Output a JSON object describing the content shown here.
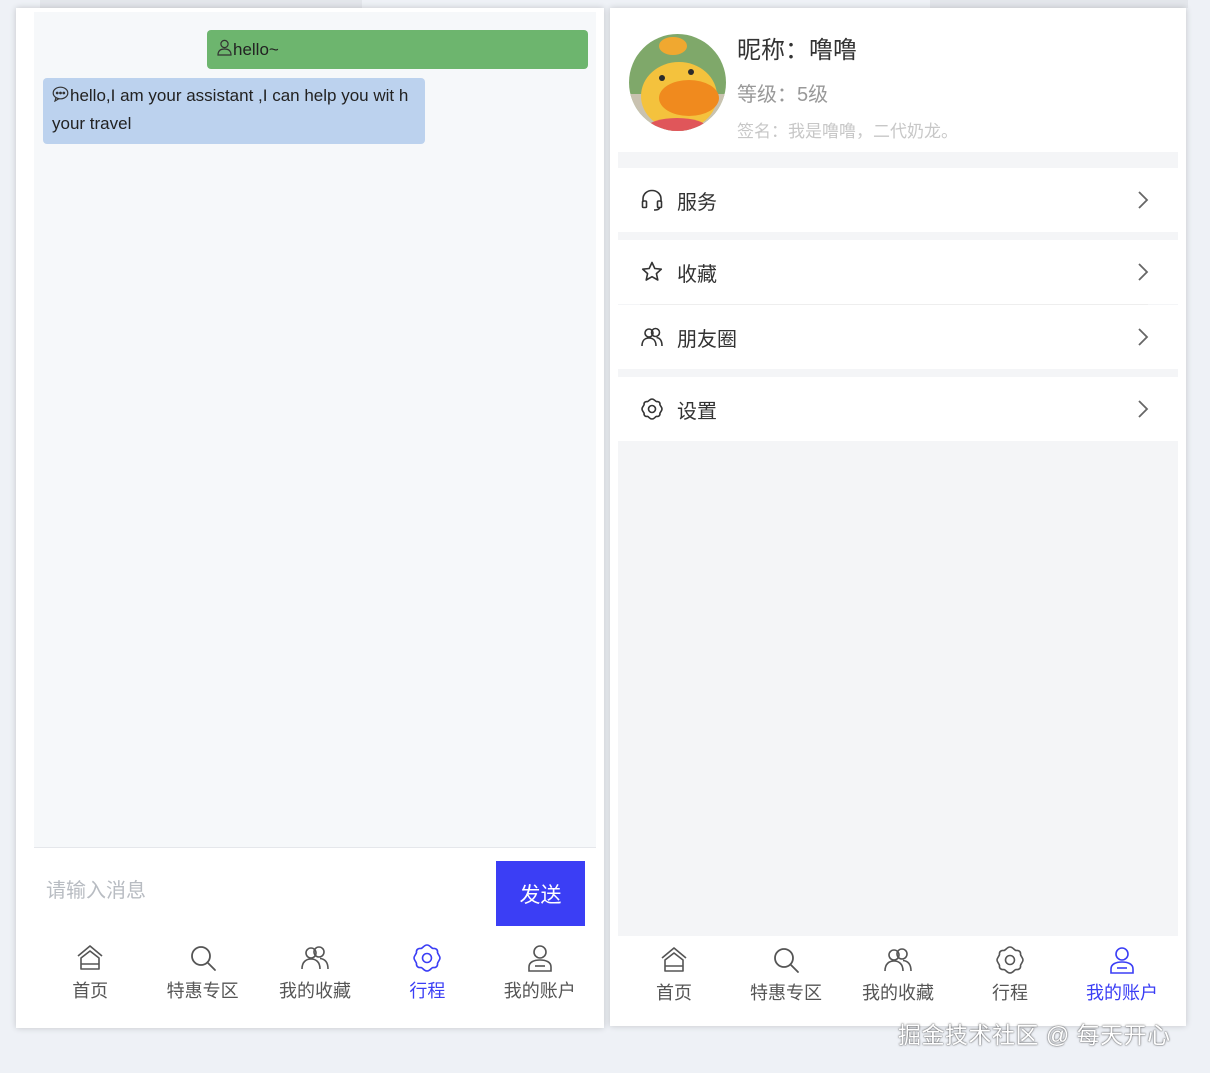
{
  "chat": {
    "messages": [
      {
        "role": "user",
        "icon": "user-icon",
        "text": "hello~"
      },
      {
        "role": "assistant",
        "icon": "chat-bubble-icon",
        "text": "hello,I am your assistant ,I can help you wit h your travel"
      }
    ],
    "input_placeholder": "请输入消息",
    "send_label": "发送"
  },
  "tabs_left": [
    {
      "label": "首页",
      "icon": "home-icon"
    },
    {
      "label": "特惠专区",
      "icon": "search-icon"
    },
    {
      "label": "我的收藏",
      "icon": "users-icon"
    },
    {
      "label": "行程",
      "icon": "flower-settings-icon",
      "active": true
    },
    {
      "label": "我的账户",
      "icon": "account-icon"
    }
  ],
  "profile": {
    "nickname": "昵称：噜噜",
    "level": "等级：5级",
    "signature": "签名：我是噜噜，二代奶龙。"
  },
  "menu": [
    {
      "label": "服务",
      "icon": "headset-icon"
    },
    {
      "label": "收藏",
      "icon": "star-icon"
    },
    {
      "label": "朋友圈",
      "icon": "friends-icon"
    },
    {
      "label": "设置",
      "icon": "settings-icon"
    }
  ],
  "tabs_right": [
    {
      "label": "首页",
      "icon": "home-icon"
    },
    {
      "label": "特惠专区",
      "icon": "search-icon"
    },
    {
      "label": "我的收藏",
      "icon": "users-icon"
    },
    {
      "label": "行程",
      "icon": "flower-settings-icon"
    },
    {
      "label": "我的账户",
      "icon": "account-icon",
      "active": true
    }
  ],
  "colors": {
    "accent": "#3b3ef5",
    "user_bubble": "#6db56e",
    "bot_bubble": "#bcd2ee"
  },
  "watermark": "掘金技术社区 @ 每天开心"
}
